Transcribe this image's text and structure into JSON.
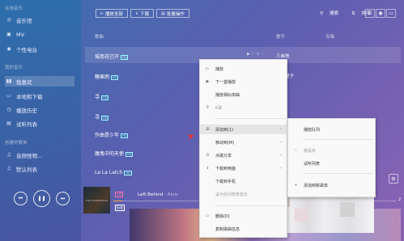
{
  "sidebar": {
    "section_online": "在线音乐",
    "online_items": [
      {
        "icon": "music-hall-icon",
        "glyph": "◎",
        "label": "音乐馆"
      },
      {
        "icon": "mv-icon",
        "glyph": "▣",
        "label": "MV"
      },
      {
        "icon": "radio-icon",
        "glyph": "◉",
        "label": "个性电台"
      }
    ],
    "section_mine": "我的音乐",
    "mine_items": [
      {
        "icon": "favorite-icon",
        "glyph": "▮▮",
        "label": "我喜欢"
      },
      {
        "icon": "local-download-icon",
        "glyph": "▭",
        "label": "本地和下载"
      },
      {
        "icon": "history-icon",
        "glyph": "◷",
        "label": "播放历史"
      },
      {
        "icon": "trial-list-icon",
        "glyph": "▤",
        "label": "试听列表"
      }
    ],
    "section_created": "创建的歌单",
    "created_items": [
      {
        "icon": "note-icon",
        "glyph": "♫",
        "label": "音频怪物..."
      },
      {
        "icon": "note-icon",
        "glyph": "♫",
        "label": "默认列表"
      }
    ]
  },
  "toolbar": {
    "play_all": "播放全部",
    "download": "下载",
    "batch": "批量操作",
    "search": "搜索",
    "sort": "排序"
  },
  "list": {
    "col_song": "歌曲",
    "col_artist": "歌手",
    "col_duration": "专辑"
  },
  "songs": [
    {
      "title": "城南花已开",
      "badge": "HQ",
      "artist": "三亩地"
    },
    {
      "title": "糖果雨",
      "badge": "HQ",
      "artist": "蓝色理子"
    },
    {
      "title": "寻",
      "badge": "HQ",
      "artist": "..."
    },
    {
      "title": "寻",
      "badge": "HQ",
      "artist": "..."
    },
    {
      "title": "作曲是少年",
      "badge": "HQ",
      "artist": "..."
    },
    {
      "title": "魔鬼中的天使",
      "badge": "HQ",
      "artist": "..."
    },
    {
      "title": "La La Latch",
      "badge": "HQ",
      "artist": "..."
    }
  ],
  "player": {
    "album_text": "THE SOUNDTRACK",
    "now_badge": "VIP",
    "now_title": "Left Behind",
    "now_artist": " - Alnis",
    "quality": "标准",
    "progress_fraction": 0.03,
    "right_number": "2"
  },
  "context_menu": {
    "items": [
      {
        "icon": "play-icon",
        "glyph": "▷",
        "label": "播放",
        "dim": false
      },
      {
        "icon": "next-play-icon",
        "glyph": "▶",
        "label": "下一首播放",
        "dim": false
      },
      {
        "icon": "similar-icon",
        "glyph": "",
        "label": "播放相似单曲",
        "dim": false
      },
      {
        "icon": "search-icon",
        "glyph": "⚲",
        "label": "K歌",
        "dim": true
      },
      {
        "icon": "add-to-icon",
        "glyph": "⊞",
        "label": "添加到(1)",
        "dim": false,
        "arrow": "›",
        "hover": true
      },
      {
        "icon": "move-icon",
        "glyph": "",
        "label": "移动到(M)",
        "dim": false,
        "arrow": "›"
      },
      {
        "icon": "share-icon",
        "glyph": "⊙",
        "label": "点歌分享",
        "dim": false,
        "arrow": "›"
      },
      {
        "icon": "download-icon",
        "glyph": "⇓",
        "label": "下载到电脑",
        "dim": false,
        "arrow": "›"
      },
      {
        "icon": "phone-icon",
        "glyph": "",
        "label": "下载到手机",
        "dim": false
      },
      {
        "icon": "ringtone-icon",
        "glyph": "",
        "label": "设为空间背景音乐",
        "dim": true
      },
      {
        "icon": "delete-icon",
        "glyph": "▭",
        "label": "删除(D)",
        "dim": false
      },
      {
        "icon": "copy-icon",
        "glyph": "",
        "label": "复制歌曲信息",
        "dim": false
      }
    ]
  },
  "submenu": {
    "items": [
      {
        "icon": "",
        "label": "播放队列",
        "dim": false
      },
      {
        "icon": "heart-icon",
        "glyph": "♡",
        "label": "我喜欢",
        "dim": true
      },
      {
        "icon": "",
        "label": "试听列表",
        "dim": false
      },
      {
        "icon": "plus-icon",
        "glyph": "+",
        "label": "添加到新歌单",
        "dim": false
      }
    ]
  }
}
